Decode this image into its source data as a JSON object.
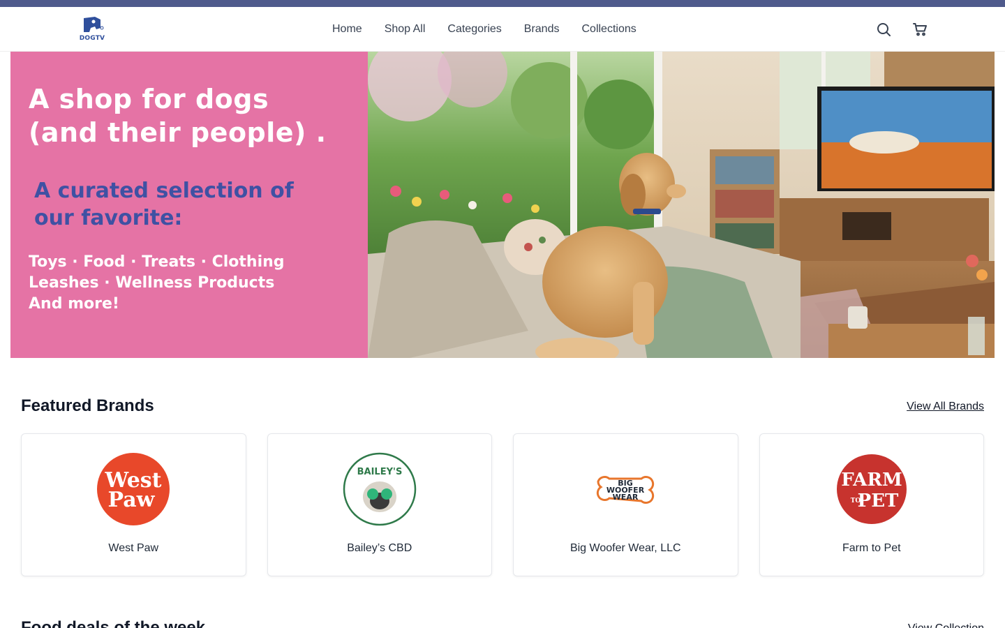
{
  "header": {
    "logo_text": "DOGTV",
    "nav": [
      "Home",
      "Shop All",
      "Categories",
      "Brands",
      "Collections"
    ]
  },
  "icons": {
    "search": "search-icon",
    "cart": "cart-icon"
  },
  "hero": {
    "title_line1": "A shop for dogs",
    "title_line2": "(and their people) .",
    "subtitle_line1": "A curated selection of",
    "subtitle_line2": "our favorite:",
    "list_line1": "Toys · Food · Treats · Clothing",
    "list_line2": "Leashes · Wellness Products",
    "list_line3": "And more!"
  },
  "featured_brands": {
    "title": "Featured Brands",
    "view_all": "View All Brands",
    "brands": [
      {
        "name": "West Paw",
        "logo_line1": "West",
        "logo_line2": "Paw"
      },
      {
        "name": "Bailey’s CBD",
        "logo_text": "BAILEY'S"
      },
      {
        "name": "Big Woofer Wear, LLC",
        "logo_line1": "BIG",
        "logo_line2": "WOOFER",
        "logo_line3": "WEAR"
      },
      {
        "name": "Farm to Pet",
        "logo_line1": "FARM",
        "logo_line2": "TO",
        "logo_line3": "PET"
      }
    ]
  },
  "next_section": {
    "title": "Food deals of the week",
    "link": "View Collection"
  },
  "colors": {
    "top_bar": "#4f5a8c",
    "hero_pink": "#e573a5",
    "hero_sub_blue": "#3f51a3",
    "brand_blue": "#2f4f9c"
  }
}
